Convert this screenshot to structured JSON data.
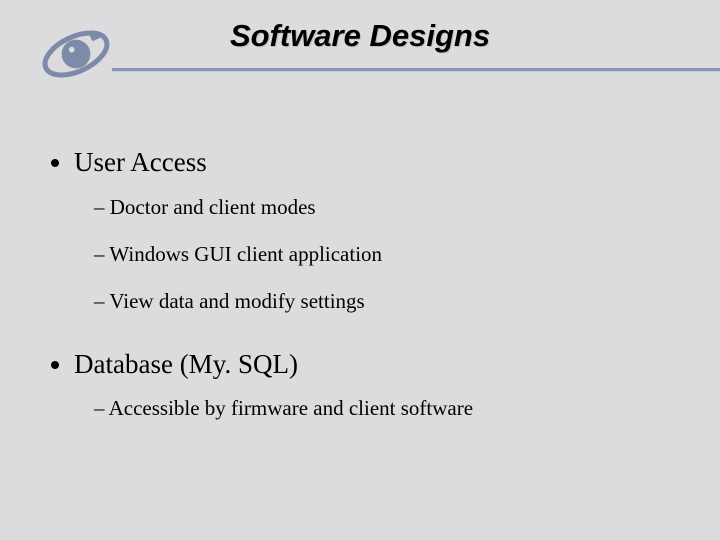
{
  "title": "Software Designs",
  "bullets": [
    {
      "text": "User Access",
      "sub": [
        "Doctor and client modes",
        "Windows GUI client application",
        "View data and modify settings"
      ]
    },
    {
      "text": "Database (My. SQL)",
      "sub": [
        "Accessible by firmware and client software"
      ]
    }
  ]
}
